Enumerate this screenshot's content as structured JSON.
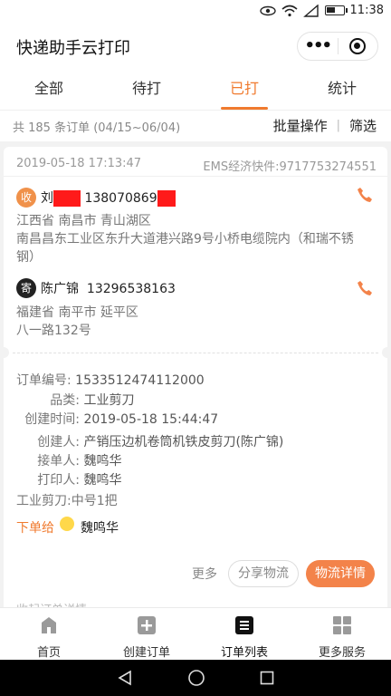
{
  "status_bar": {
    "time": "11:38"
  },
  "app": {
    "title": "快递助手云打印"
  },
  "tabs": [
    {
      "label": "全部"
    },
    {
      "label": "待打"
    },
    {
      "label": "已打",
      "active": true
    },
    {
      "label": "统计"
    }
  ],
  "summary": {
    "count_text": "共 185 条订单 (04/15~06/04)",
    "batch_label": "批量操作",
    "divider": "|",
    "filter_label": "筛选"
  },
  "order": {
    "printed_time": "2019-05-18 17:13:47",
    "carrier_tracking": "EMS经济快件:9717753274551",
    "receiver": {
      "badge": "收",
      "name": "刘",
      "phone": "138070869",
      "address_line1": "江西省 南昌市 青山湖区",
      "address_line2": "南昌昌东工业区东升大道港兴路9号小桥电缆院内（和瑞不锈",
      "address_line3": "钢）"
    },
    "sender": {
      "badge": "寄",
      "name": "陈广锦",
      "phone": "13296538163",
      "address_line1": "福建省 南平市 延平区",
      "address_line2": "八一路132号"
    },
    "details": {
      "order_no_label": "订单编号:",
      "order_no": "1533512474112000",
      "category_label": "品类:",
      "category": "工业剪刀",
      "created_time_label": "创建时间:",
      "created_time": "2019-05-18 15:44:47",
      "creator_label": "创建人:",
      "creator": "产销压边机卷筒机铁皮剪刀(陈广锦)",
      "receiver_label": "接单人:",
      "receiver_person": "魏鸣华",
      "printer_label": "打印人:",
      "printer_person": "魏鸣华",
      "item_line": "工业剪刀:中号1把"
    },
    "assign": {
      "label": "下单给",
      "name": "魏鸣华"
    },
    "buttons": {
      "more": "更多",
      "share": "分享物流",
      "detail": "物流详情"
    },
    "peek_text": "收起订单详情"
  },
  "bottom_nav": [
    {
      "label": "首页",
      "icon": "home-icon"
    },
    {
      "label": "创建订单",
      "icon": "plus-square-icon"
    },
    {
      "label": "订单列表",
      "icon": "list-icon",
      "active": true
    },
    {
      "label": "更多服务",
      "icon": "grid-icon"
    }
  ],
  "colors": {
    "accent": "#f07a2e",
    "receiver_badge": "#f0914a",
    "sender_badge": "#222222",
    "redaction": "#ff1a1a"
  }
}
